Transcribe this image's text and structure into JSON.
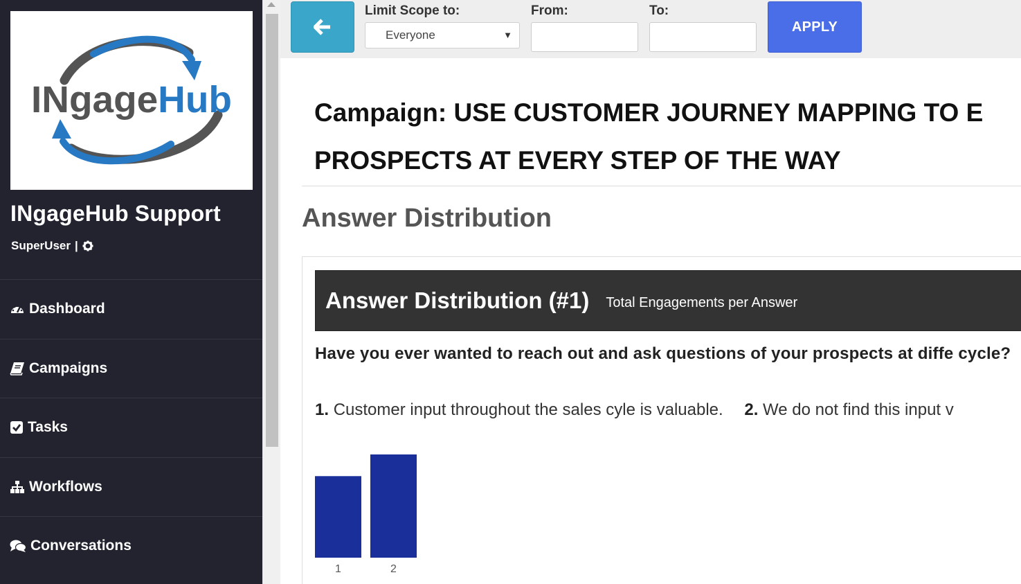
{
  "sidebar": {
    "logo_text": "INgageHub",
    "org_name": "INgageHub Support",
    "user_role": "SuperUser",
    "separator": "|",
    "nav": [
      {
        "label": "Dashboard",
        "icon": "dashboard-icon"
      },
      {
        "label": "Campaigns",
        "icon": "book-icon"
      },
      {
        "label": "Tasks",
        "icon": "checkbox-icon"
      },
      {
        "label": "Workflows",
        "icon": "sitemap-icon"
      },
      {
        "label": "Conversations",
        "icon": "comments-icon"
      }
    ]
  },
  "toolbar": {
    "scope_label": "Limit Scope to:",
    "scope_value": "Everyone",
    "from_label": "From:",
    "to_label": "To:",
    "from_value": "",
    "to_value": "",
    "apply_label": "APPLY"
  },
  "main": {
    "campaign_line1": "Campaign: USE CUSTOMER JOURNEY MAPPING TO E",
    "campaign_line2": "PROSPECTS AT EVERY STEP OF THE WAY",
    "section_heading": "Answer Distribution",
    "panel": {
      "title": "Answer Distribution (#1)",
      "subtitle": "Total Engagements per Answer",
      "question": "Have you ever wanted to reach out and ask questions of your prospects at diffe cycle?",
      "answers": [
        {
          "num": "1.",
          "text": "Customer input throughout the sales cyle is valuable."
        },
        {
          "num": "2.",
          "text": "We do not find this input v"
        }
      ]
    }
  },
  "colors": {
    "sidebar_bg": "#22232f",
    "back_button": "#3aa6c9",
    "apply_button": "#4a6ee8",
    "bar_color": "#1a2f9a",
    "logo_gray": "#545454",
    "logo_blue": "#2779c4"
  },
  "chart_data": {
    "type": "bar",
    "categories": [
      "1",
      "2"
    ],
    "values": [
      0.79,
      1.0
    ],
    "title": "",
    "xlabel": "",
    "ylabel": "",
    "grid": false,
    "bar_color": "#1a2f9a"
  }
}
